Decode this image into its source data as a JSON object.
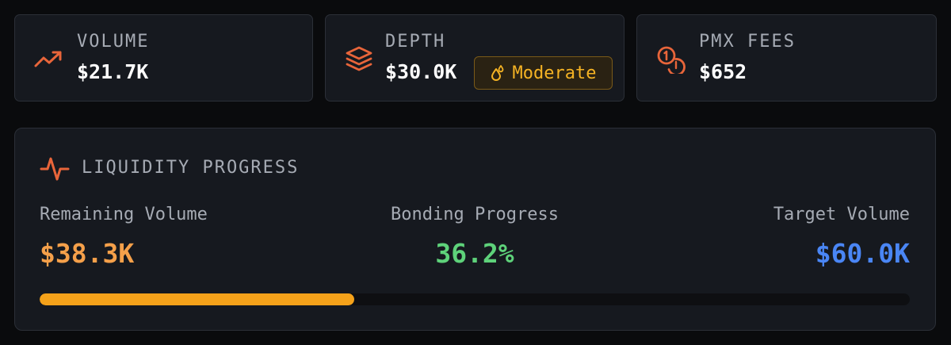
{
  "stats": [
    {
      "label": "VOLUME",
      "value": "$21.7K",
      "icon": "trending-up-icon"
    },
    {
      "label": "DEPTH",
      "value": "$30.0K",
      "icon": "layers-icon"
    },
    {
      "label": "PMX FEES",
      "value": "$652",
      "icon": "coins-icon"
    }
  ],
  "depth_badge": {
    "label": "Moderate",
    "icon": "droplets-icon",
    "color": "#f5b324"
  },
  "liquidity": {
    "title": "LIQUIDITY PROGRESS",
    "icon": "activity-icon",
    "remaining": {
      "label": "Remaining Volume",
      "value": "$38.3K",
      "color": "#f5a04a"
    },
    "bonding": {
      "label": "Bonding Progress",
      "value": "36.2%",
      "color": "#5ed27a"
    },
    "target": {
      "label": "Target Volume",
      "value": "$60.0K",
      "color": "#4a86f5"
    },
    "progress_percent": 36.2,
    "progress_color": "#f5a21a"
  },
  "colors": {
    "accent": "#e8653a",
    "background": "#0a0b0d",
    "card": "#16191f",
    "border": "#2b2f37"
  }
}
